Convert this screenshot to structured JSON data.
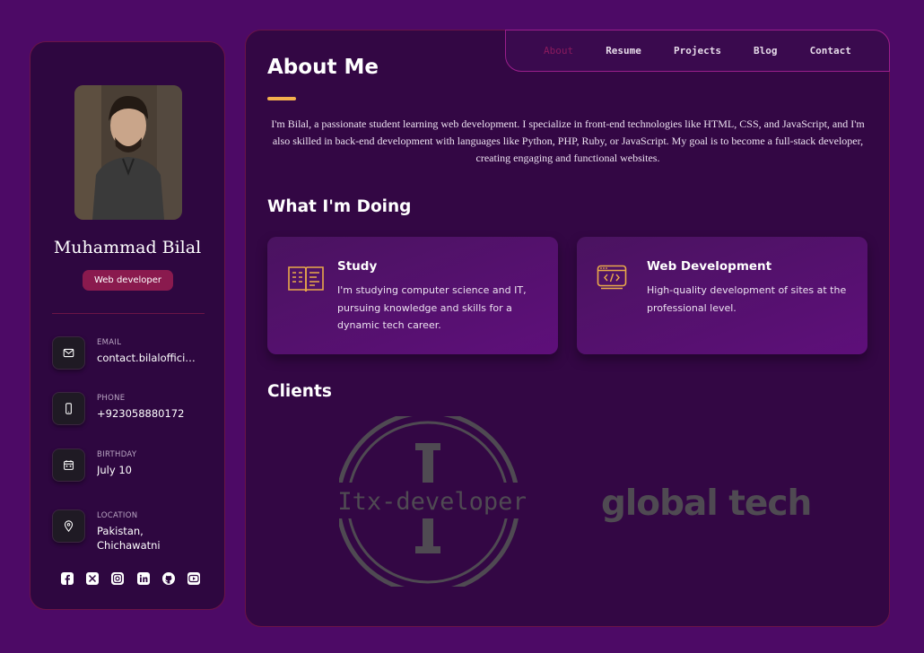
{
  "profile": {
    "name": "Muhammad Bilal",
    "role": "Web developer"
  },
  "contacts": [
    {
      "label": "EMAIL",
      "value": "contact.bilalofficial...",
      "icon": "mail-icon"
    },
    {
      "label": "PHONE",
      "value": "+923058880172",
      "icon": "phone-icon"
    },
    {
      "label": "BIRTHDAY",
      "value": "July 10",
      "icon": "calendar-icon"
    },
    {
      "label": "LOCATION",
      "value": "Pakistan, Chichawatni",
      "icon": "location-icon"
    }
  ],
  "socials": [
    "facebook-icon",
    "x-icon",
    "instagram-icon",
    "linkedin-icon",
    "github-icon",
    "youtube-icon"
  ],
  "nav": {
    "about": "About",
    "resume": "Resume",
    "projects": "Projects",
    "blog": "Blog",
    "contact": "Contact",
    "active": "About"
  },
  "about": {
    "title": "About Me",
    "text": "I'm Bilal, a passionate student learning web development. I specialize in front-end technologies like HTML, CSS, and JavaScript, and I'm also skilled in back-end development with languages like Python, PHP, Ruby, or JavaScript. My goal is to become a full-stack developer, creating engaging and functional websites."
  },
  "doing": {
    "title": "What I'm Doing",
    "cards": [
      {
        "title": "Study",
        "text": "I'm studying computer science and IT, pursuing knowledge and skills for a dynamic tech career.",
        "icon": "book-icon"
      },
      {
        "title": "Web Development",
        "text": "High-quality development of sites at the professional level.",
        "icon": "code-window-icon"
      }
    ]
  },
  "clients": {
    "title": "Clients",
    "logos": [
      "Itx-developer",
      "global tech"
    ]
  },
  "colors": {
    "background": "#4d0a66",
    "panel": "#330744",
    "accent": "#f3b04d",
    "badge": "#8a1a4e"
  }
}
